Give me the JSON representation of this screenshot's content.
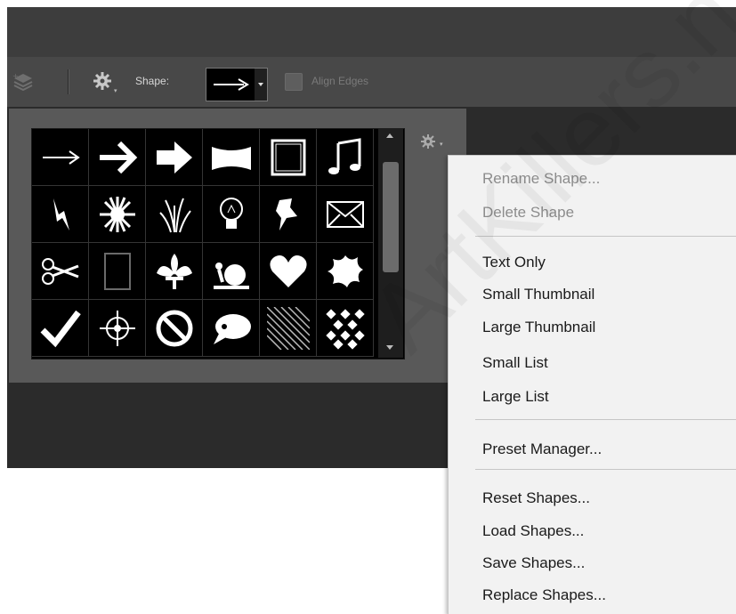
{
  "options_bar": {
    "shape_label": "Shape:",
    "align_edges_label": "Align Edges"
  },
  "shapes_panel": {
    "shapes": [
      [
        "arrow-thin",
        "arrow-bold",
        "arrow-heavy",
        "banner",
        "frame",
        "music-note"
      ],
      [
        "lightning",
        "starburst",
        "grass",
        "lightbulb",
        "pushpin",
        "envelope"
      ],
      [
        "scissors",
        "frame-rect",
        "fleur-de-lis",
        "snail",
        "heart",
        "splat"
      ],
      [
        "checkmark",
        "target",
        "no-sign",
        "speech-bubble",
        "diagonal-pattern",
        "checker-pattern"
      ]
    ]
  },
  "context_menu": {
    "items": [
      {
        "label": "Rename Shape...",
        "disabled": true
      },
      {
        "label": "Delete Shape",
        "disabled": true
      },
      {
        "label": "Text Only",
        "disabled": false
      },
      {
        "label": "Small Thumbnail",
        "disabled": false
      },
      {
        "label": "Large Thumbnail",
        "disabled": false
      },
      {
        "label": "Small List",
        "disabled": false
      },
      {
        "label": "Large List",
        "disabled": false
      },
      {
        "label": "Preset Manager...",
        "disabled": false
      },
      {
        "label": "Reset Shapes...",
        "disabled": false
      },
      {
        "label": "Load Shapes...",
        "disabled": false
      },
      {
        "label": "Save Shapes...",
        "disabled": false
      },
      {
        "label": "Replace Shapes...",
        "disabled": false
      }
    ]
  },
  "watermark": "ArtKillers.n"
}
